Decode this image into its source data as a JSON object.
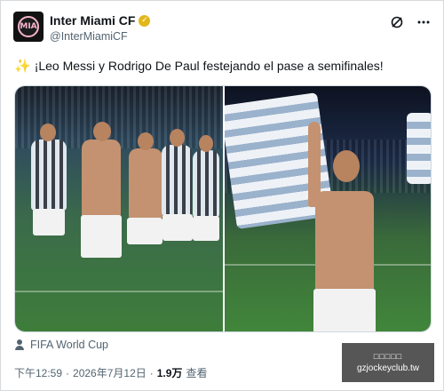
{
  "author": {
    "display_name": "Inter Miami CF",
    "handle": "@InterMiamiCF",
    "verified_badge_color": "#e2b719",
    "avatar_text": "MIA"
  },
  "header_icons": [
    "grok-icon",
    "more-icon"
  ],
  "tweet": {
    "emoji": "✨",
    "text": "¡Leo Messi y Rodrigo De Paul festejando el pase a semifinales!"
  },
  "location": {
    "label": "FIFA World Cup"
  },
  "meta": {
    "time": "下午12:59",
    "separator": "·",
    "date": "2026年7月12日",
    "views_count": "1.9万",
    "views_label": "查看"
  },
  "watermark": {
    "title": "□□□□□",
    "url": "gzjockeyclub.tw"
  }
}
